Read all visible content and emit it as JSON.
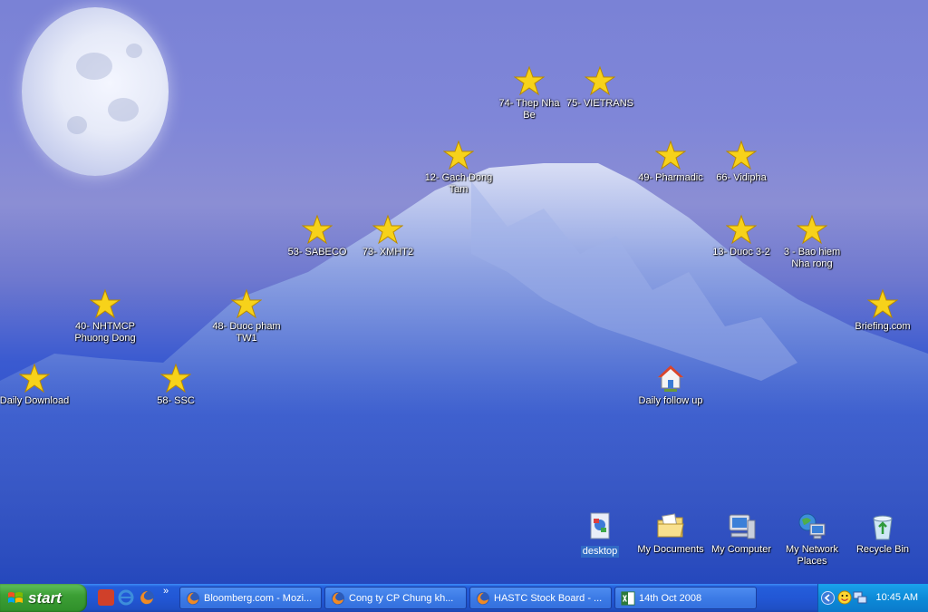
{
  "desktop_icons": {
    "thep_nha_be": "74- Thep Nha Be",
    "vietrans": "75- VIETRANS",
    "gach_dong_tam": "12- Gach Dong Tam",
    "pharmadic": "49- Pharmadic",
    "vidipha": "66- Vidipha",
    "sabeco": "53- SABECO",
    "xmht2": "73- XMHT2",
    "duoc_3_2": "13- Duoc 3-2",
    "bao_hiem": "3 - Bao hiem Nha rong",
    "briefing": "Briefing.com",
    "nhtmcp": "40- NHTMCP Phuong Dong",
    "duoc_pham_tw1": "48- Duoc pham TW1",
    "daily_download": "Daily Download",
    "ssc": "58- SSC",
    "daily_follow_up": "Daily follow up",
    "desktop": "desktop",
    "my_documents": "My Documents",
    "my_computer": "My Computer",
    "my_network_places": "My Network Places",
    "recycle_bin": "Recycle Bin"
  },
  "taskbar": {
    "start_label": "start",
    "tasks": [
      {
        "label": "Bloomberg.com - Mozi...",
        "icon": "firefox-icon"
      },
      {
        "label": "Cong ty CP Chung kh...",
        "icon": "firefox-icon"
      },
      {
        "label": "HASTC Stock Board - ...",
        "icon": "firefox-icon"
      },
      {
        "label": "14th Oct 2008",
        "icon": "excel-icon"
      }
    ],
    "clock": "10:45 AM"
  },
  "colors": {
    "taskbar_blue": "#245edb",
    "start_green": "#3c9f35",
    "tray_blue": "#0d8ad8",
    "star_yellow": "#f7d21a"
  }
}
